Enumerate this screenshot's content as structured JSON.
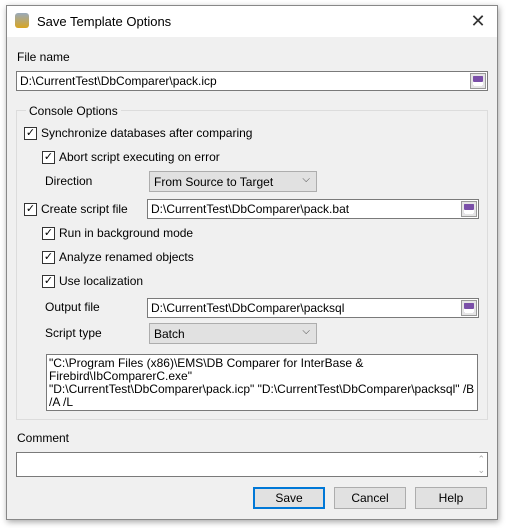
{
  "window": {
    "title": "Save Template Options",
    "close_icon": "close-icon"
  },
  "file_name": {
    "label": "File name",
    "value": "D:\\CurrentTest\\DbComparer\\pack.icp"
  },
  "console_options": {
    "legend": "Console Options",
    "synchronize": {
      "label": "Synchronize databases after comparing",
      "checked": true
    },
    "abort": {
      "label": "Abort script executing on error",
      "checked": true
    },
    "direction": {
      "label": "Direction",
      "value": "From Source to Target"
    },
    "create_script": {
      "label": "Create script file",
      "checked": true,
      "value": "D:\\CurrentTest\\DbComparer\\pack.bat"
    },
    "background": {
      "label": "Run in background mode",
      "checked": true
    },
    "analyze": {
      "label": "Analyze renamed objects",
      "checked": true
    },
    "localization": {
      "label": "Use localization",
      "checked": true
    },
    "output_file": {
      "label": "Output file",
      "value": "D:\\CurrentTest\\DbComparer\\packsql"
    },
    "script_type": {
      "label": "Script type",
      "value": "Batch"
    },
    "command_line": [
      "\"C:\\Program Files (x86)\\EMS\\DB Comparer for InterBase & Firebird\\IbComparerC.exe\"",
      "\"D:\\CurrentTest\\DbComparer\\pack.icp\" \"D:\\CurrentTest\\DbComparer\\packsql\" /B /A /L"
    ]
  },
  "comment": {
    "label": "Comment",
    "value": ""
  },
  "buttons": {
    "save": "Save",
    "cancel": "Cancel",
    "help": "Help"
  }
}
